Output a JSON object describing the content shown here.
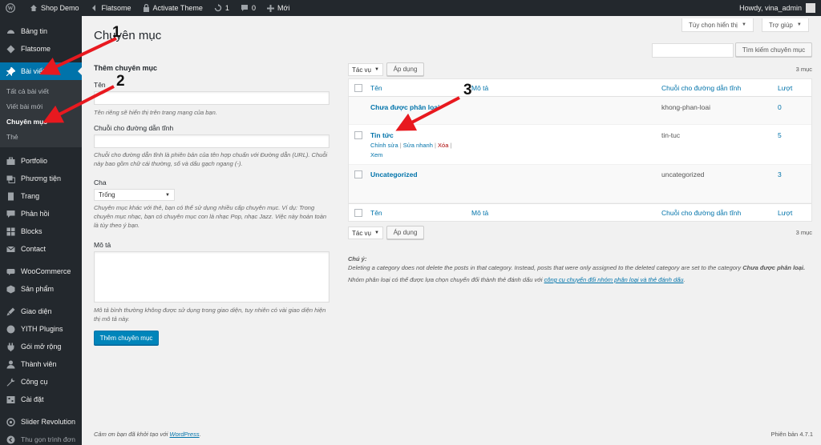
{
  "adminbar": {
    "site_name": "Shop Demo",
    "theme": "Flatsome",
    "activate_theme": "Activate Theme",
    "updates_count": "1",
    "comments_count": "0",
    "new_label": "Mới",
    "greeting": "Howdy, vina_admin"
  },
  "sidebar": {
    "items_top": [
      {
        "label": "Bảng tin",
        "icon": "dashboard-icon"
      },
      {
        "label": "Flatsome",
        "icon": "flatsome-icon"
      }
    ],
    "posts": {
      "label": "Bài viết",
      "icon": "pin-icon"
    },
    "posts_sub": [
      "Tất cả bài viết",
      "Viết bài mới",
      "Chuyên mục",
      "Thẻ"
    ],
    "items_mid": [
      {
        "label": "Portfolio",
        "icon": "portfolio-icon"
      },
      {
        "label": "Phương tiện",
        "icon": "media-icon"
      },
      {
        "label": "Trang",
        "icon": "page-icon"
      },
      {
        "label": "Phản hồi",
        "icon": "comment-icon"
      },
      {
        "label": "Blocks",
        "icon": "blocks-icon"
      },
      {
        "label": "Contact",
        "icon": "mail-icon"
      }
    ],
    "items_shop": [
      {
        "label": "WooCommerce",
        "icon": "woo-icon"
      },
      {
        "label": "Sản phẩm",
        "icon": "product-icon"
      }
    ],
    "items_bottom": [
      {
        "label": "Giao diện",
        "icon": "appearance-icon"
      },
      {
        "label": "YITH Plugins",
        "icon": "yith-icon"
      },
      {
        "label": "Gói mở rộng",
        "icon": "plugin-icon"
      },
      {
        "label": "Thành viên",
        "icon": "users-icon"
      },
      {
        "label": "Công cụ",
        "icon": "tools-icon"
      },
      {
        "label": "Cài đặt",
        "icon": "settings-icon"
      }
    ],
    "slider": {
      "label": "Slider Revolution",
      "icon": "slider-icon"
    },
    "collapse": {
      "label": "Thu gọn trình đơn",
      "icon": "collapse-icon"
    }
  },
  "header": {
    "screen_options": "Tùy chọn hiển thị",
    "help": "Trợ giúp",
    "page_title": "Chuyên mục",
    "search_button": "Tìm kiếm chuyên mục",
    "search_value": ""
  },
  "form": {
    "heading": "Thêm chuyên mục",
    "name_label": "Tên",
    "name_help": "Tên riêng sẽ hiển thị trên trang mạng của bạn.",
    "slug_label": "Chuỗi cho đường dẫn tĩnh",
    "slug_help": "Chuỗi cho đường dẫn tĩnh là phiên bản của tên hợp chuẩn với Đường dẫn (URL). Chuỗi này bao gồm chữ cái thường, số và dấu gạch ngang (-).",
    "parent_label": "Cha",
    "parent_value": "Trống",
    "parent_help": "Chuyên mục khác với thẻ, bạn có thể sử dụng nhiều cấp chuyên mục. Ví dụ: Trong chuyên mục nhạc, bạn có chuyên mục con là nhạc Pop, nhạc Jazz. Việc này hoàn toàn là tùy theo ý bạn.",
    "desc_label": "Mô tả",
    "desc_help": "Mô tả bình thường không được sử dụng trong giao diện, tuy nhiên có vài giao diện hiện thị mô tả này.",
    "submit": "Thêm chuyên mục"
  },
  "table": {
    "bulk_label": "Tác vụ",
    "apply_label": "Áp dụng",
    "count_text": "3 mục",
    "columns": {
      "name": "Tên",
      "description": "Mô tả",
      "slug": "Chuỗi cho đường dẫn tĩnh",
      "count": "Lượt"
    },
    "rows": [
      {
        "name": "Chưa được phân loại",
        "slug": "khong-phan-loai",
        "count": "0"
      },
      {
        "name": "Tin tức",
        "slug": "tin-tuc",
        "count": "5",
        "actions": {
          "edit": "Chỉnh sửa",
          "quick": "Sửa nhanh",
          "delete": "Xóa",
          "view": "Xem"
        }
      },
      {
        "name": "Uncategorized",
        "slug": "uncategorized",
        "count": "3"
      }
    ]
  },
  "notes": {
    "title": "Chú ý:",
    "line1": "Deleting a category does not delete the posts in that category. Instead, posts that were only assigned to the deleted category are set to the category",
    "line1_bold": "Chưa được phân loại.",
    "line2_prefix": "Nhóm phân loại có thể được lựa chọn chuyển đổi thành thẻ đánh dấu với",
    "line2_link": "công cụ chuyển đổi nhóm phân loại và thẻ đánh dấu"
  },
  "footer": {
    "thanks_prefix": "Cảm ơn bạn đã khởi tạo với",
    "wordpress": "WordPress",
    "version": "Phiên bản 4.7.1"
  },
  "annotations": [
    "1",
    "2",
    "3"
  ],
  "colors": {
    "admin_dark": "#23282d",
    "accent": "#0073aa",
    "arrow": "#e8191f"
  }
}
